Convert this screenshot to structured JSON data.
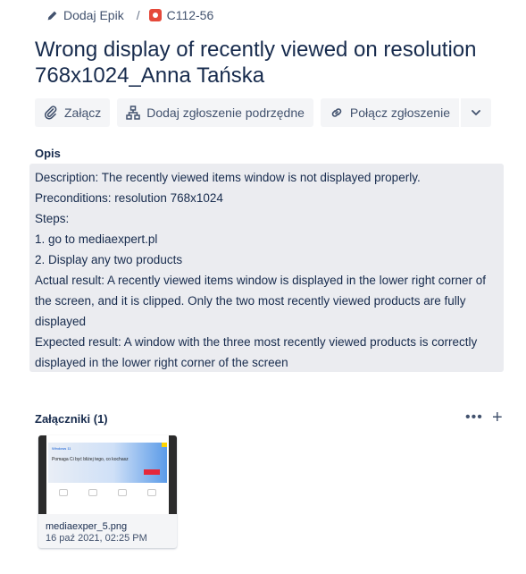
{
  "breadcrumb": {
    "epic_label": "Dodaj Epik",
    "separator": "/",
    "issue_key": "C112-56"
  },
  "issue": {
    "title": "Wrong display of recently viewed on resolution 768x1024_Anna Tańska"
  },
  "actions": {
    "attach": "Załącz",
    "add_subtask": "Dodaj zgłoszenie podrzędne",
    "link_issue": "Połącz zgłoszenie"
  },
  "description": {
    "label": "Opis",
    "lines": [
      "Description: The recently viewed items window is not displayed properly.",
      "Preconditions: resolution 768x1024",
      "Steps:",
      "1. go to mediaexpert.pl",
      "2. Display any two products",
      "Actual result: A recently viewed items window is displayed in the lower right corner of the screen, and it is clipped. Only the two most recently viewed products are fully displayed",
      "Expected result: A window with the three most recently viewed products is correctly displayed in the lower right corner of the screen"
    ]
  },
  "attachments": {
    "header": "Załączniki (1)",
    "more_label": "•••",
    "add_label": "+",
    "items": [
      {
        "filename": "mediaexper_5.png",
        "date": "16 paź 2021, 02:25 PM",
        "preview_title": "Windows 11",
        "preview_text": "Pomaga Ci być bliżej tego, co kochasz"
      }
    ]
  },
  "colors": {
    "bug_red": "#e5493a",
    "text_primary": "#172b4d",
    "button_bg": "#f4f5f7",
    "description_bg": "#ebecf0"
  }
}
